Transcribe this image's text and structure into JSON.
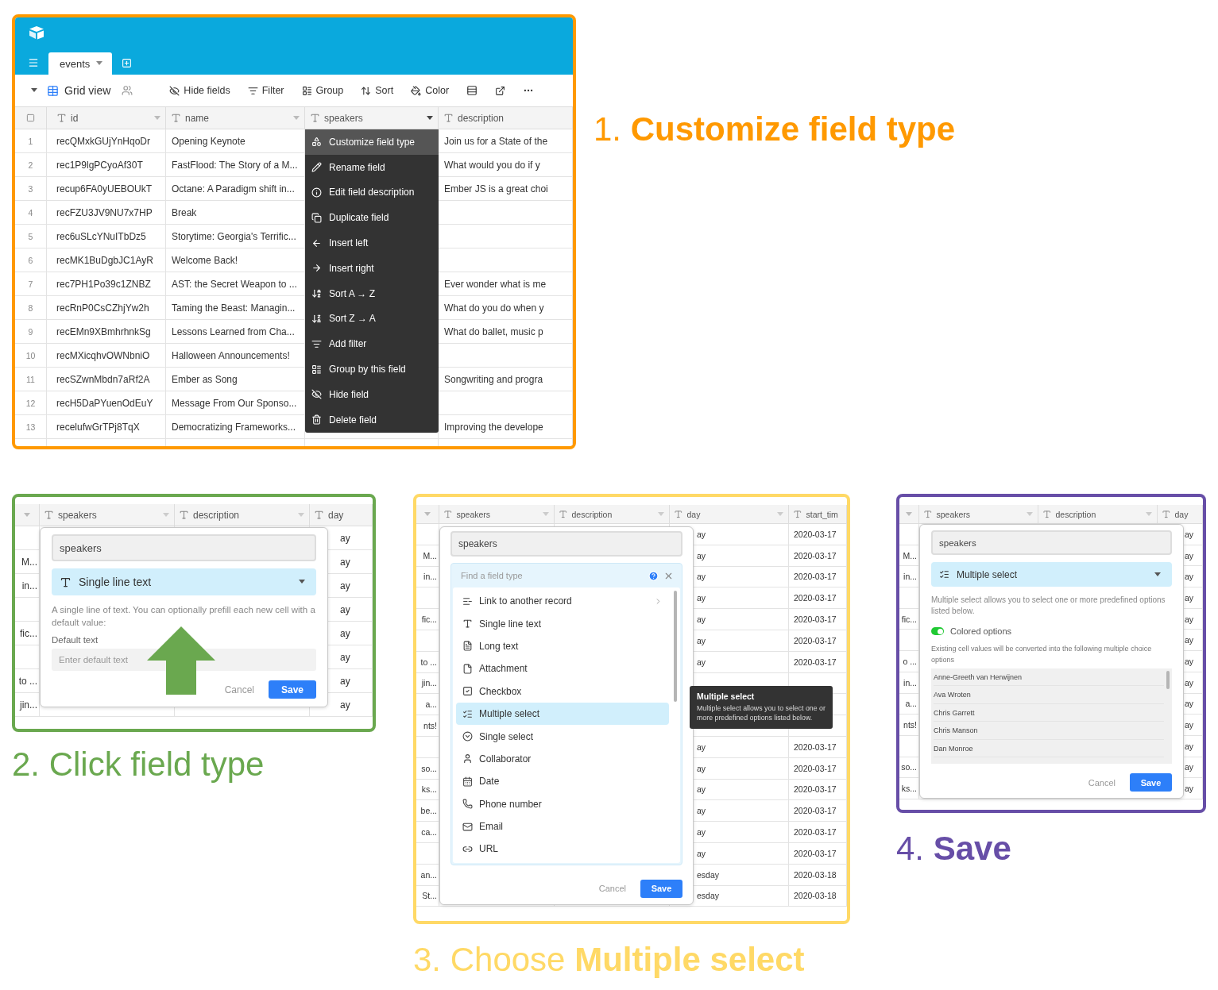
{
  "steps": [
    {
      "kind": "grid_menu",
      "color": "#ff9900",
      "caption": "1. **Customize field type**",
      "tab": "events",
      "view": "Grid view",
      "tools": [
        "Hide fields",
        "Filter",
        "Group",
        "Sort",
        "Color"
      ],
      "columns": [
        "id",
        "name",
        "speakers",
        "description"
      ],
      "rows": [
        {
          "num": "1",
          "id": "recQMxkGUjYnHqoDr",
          "name": "Opening Keynote",
          "description": "Join us for a State of the"
        },
        {
          "num": "2",
          "id": "rec1P9lgPCyoAf30T",
          "name": "FastFlood: The Story of a M...",
          "description": "What would you do if y"
        },
        {
          "num": "3",
          "id": "recup6FA0yUEBOUkT",
          "name": "Octane: A Paradigm shift in...",
          "description": "Ember JS is a great choi"
        },
        {
          "num": "4",
          "id": "recFZU3JV9NU7x7HP",
          "name": "Break"
        },
        {
          "num": "5",
          "id": "rec6uSLcYNuITbDz5",
          "name": "Storytime: Georgia's Terrific..."
        },
        {
          "num": "6",
          "id": "recMK1BuDgbJC1AyR",
          "name": "Welcome Back!"
        },
        {
          "num": "7",
          "id": "rec7PH1Po39c1ZNBZ",
          "name": "AST: the Secret Weapon to ...",
          "description": "Ever wonder what is me"
        },
        {
          "num": "8",
          "id": "recRnP0CsCZhjYw2h",
          "name": "Taming the Beast: Managin...",
          "description": "What do you do when y"
        },
        {
          "num": "9",
          "id": "recEMn9XBmhrhnkSg",
          "name": "Lessons Learned from Cha...",
          "description": "What do ballet, music p"
        },
        {
          "num": "10",
          "id": "recMXicqhvOWNbniO",
          "name": "Halloween Announcements!"
        },
        {
          "num": "11",
          "id": "recSZwnMbdn7aRf2A",
          "name": "Ember as Song",
          "description": "Songwriting and progra"
        },
        {
          "num": "12",
          "id": "recH5DaPYuenOdEuY",
          "name": "Message From Our Sponso..."
        },
        {
          "num": "13",
          "id": "recelufwGrTPj8TqX",
          "name": "Democratizing Frameworks...",
          "description": "Improving the develope"
        }
      ],
      "menu": [
        {
          "label": "Customize field type",
          "selected": true
        },
        {
          "label": "Rename field",
          "selected": false
        },
        {
          "label": "Edit field description",
          "selected": false
        },
        {
          "label": "Duplicate field",
          "selected": false
        },
        {
          "label": "Insert left",
          "selected": false
        },
        {
          "label": "Insert right",
          "selected": false
        },
        {
          "label": "Sort A → Z",
          "selected": false
        },
        {
          "label": "Sort Z → A",
          "selected": false
        },
        {
          "label": "Add filter",
          "selected": false
        },
        {
          "label": "Group by this field",
          "selected": false
        },
        {
          "label": "Hide field",
          "selected": false
        },
        {
          "label": "Delete field",
          "selected": false
        }
      ]
    },
    {
      "kind": "dialog_text",
      "color": "#6aa84f",
      "caption": "2. Click field type",
      "columns": [
        "speakers",
        "description",
        "day"
      ],
      "rows": [
        {
          "right": "ay"
        },
        {
          "left": "M...",
          "right": "ay"
        },
        {
          "left": "in...",
          "right": "ay"
        },
        {
          "right": "ay"
        },
        {
          "left": "fic...",
          "right": "ay"
        },
        {
          "right": "ay"
        },
        {
          "left": "to ...",
          "right": "ay"
        },
        {
          "left": "jin...",
          "right": "ay"
        }
      ],
      "dialog": {
        "name": "speakers",
        "field_type": "Single line text",
        "description": "A single line of text. You can optionally prefill each new cell with a default value:",
        "default_label": "Default text",
        "default_placeholder": "Enter default text",
        "cancel": "Cancel",
        "save": "Save"
      }
    },
    {
      "kind": "dialog_picker",
      "color": "#ffd966",
      "caption": "3. Choose **Multiple select**",
      "columns": [
        "speakers",
        "description",
        "day",
        "start_tim"
      ],
      "rows": [
        {
          "day": "ay",
          "start": "2020-03-17"
        },
        {
          "left": "M...",
          "day": "ay",
          "start": "2020-03-17"
        },
        {
          "left": "in...",
          "day": "ay",
          "start": "2020-03-17"
        },
        {
          "day": "ay",
          "start": "2020-03-17"
        },
        {
          "left": "fic...",
          "day": "ay",
          "start": "2020-03-17"
        },
        {
          "day": "ay",
          "start": "2020-03-17"
        },
        {
          "left": "to ...",
          "day": "ay",
          "start": "2020-03-17"
        },
        {
          "left": "jin..."
        },
        {
          "left": "a..."
        },
        {
          "left": "nts!"
        },
        {
          "day": "ay",
          "start": "2020-03-17"
        },
        {
          "left": "so...",
          "day": "ay",
          "start": "2020-03-17"
        },
        {
          "left": "ks...",
          "day": "ay",
          "start": "2020-03-17"
        },
        {
          "left": "be...",
          "day": "ay",
          "start": "2020-03-17"
        },
        {
          "left": "ca...",
          "day": "ay",
          "start": "2020-03-17"
        },
        {
          "day": "ay",
          "start": "2020-03-17"
        },
        {
          "left": "an...",
          "day": "esday",
          "start": "2020-03-18"
        },
        {
          "left": "St...",
          "day": "esday",
          "start": "2020-03-18"
        }
      ],
      "dialog": {
        "name": "speakers",
        "search_placeholder": "Find a field type",
        "types": [
          {
            "label": "Link to another record",
            "selected": false
          },
          {
            "label": "Single line text",
            "selected": false
          },
          {
            "label": "Long text",
            "selected": false
          },
          {
            "label": "Attachment",
            "selected": false
          },
          {
            "label": "Checkbox",
            "selected": false
          },
          {
            "label": "Multiple select",
            "selected": true
          },
          {
            "label": "Single select",
            "selected": false
          },
          {
            "label": "Collaborator",
            "selected": false
          },
          {
            "label": "Date",
            "selected": false
          },
          {
            "label": "Phone number",
            "selected": false
          },
          {
            "label": "Email",
            "selected": false
          },
          {
            "label": "URL",
            "selected": false
          }
        ],
        "tooltip": {
          "title": "Multiple select",
          "text": "Multiple select allows you to select one or more predefined options listed below."
        },
        "cancel": "Cancel",
        "save": "Save"
      }
    },
    {
      "kind": "dialog_multi",
      "color": "#674ea7",
      "caption": "4. **Save**",
      "columns": [
        "speakers",
        "description",
        "day"
      ],
      "rows": [
        {
          "right": "ay"
        },
        {
          "left": "M...",
          "right": "ay"
        },
        {
          "left": "in...",
          "right": "ay"
        },
        {
          "right": "ay"
        },
        {
          "left": "fic...",
          "right": "ay"
        },
        {
          "right": "ay"
        },
        {
          "left": "o ...",
          "right": "ay"
        },
        {
          "left": "in...",
          "right": "ay"
        },
        {
          "left": "a...",
          "right": "ay"
        },
        {
          "left": "nts!",
          "right": "ay"
        },
        {
          "right": "ay"
        },
        {
          "left": "so...",
          "right": "ay"
        },
        {
          "left": "ks...",
          "right": "ay"
        }
      ],
      "dialog": {
        "name": "speakers",
        "field_type": "Multiple select",
        "description": "Multiple select allows you to select one or more predefined options listed below.",
        "toggle": {
          "label": "Colored options",
          "on": true
        },
        "note": "Existing cell values will be converted into the following multiple choice options",
        "options": [
          "Anne-Greeth van Herwijnen",
          "Ava Wroten",
          "Chris Garrett",
          "Chris Manson",
          "Dan Monroe"
        ],
        "cancel": "Cancel",
        "save": "Save"
      }
    }
  ]
}
